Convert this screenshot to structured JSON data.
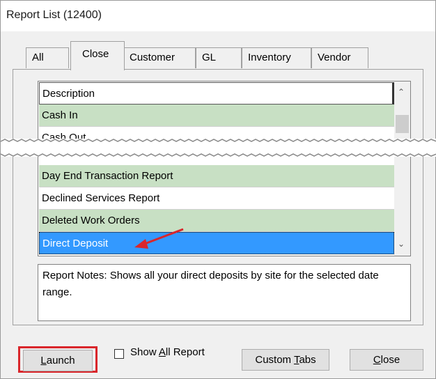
{
  "window": {
    "title": "Report List (12400)"
  },
  "tabs": [
    {
      "label": "All"
    },
    {
      "label": "Close"
    },
    {
      "label": "Customer"
    },
    {
      "label": "GL"
    },
    {
      "label": "Inventory"
    },
    {
      "label": "Vendor"
    }
  ],
  "list": {
    "header": "Description",
    "rows_top": [
      {
        "label": "Cash In"
      },
      {
        "label": "Cash Out"
      }
    ],
    "rows_bottom": [
      {
        "label": "Day End Transaction Report"
      },
      {
        "label": "Declined Services Report"
      },
      {
        "label": "Deleted Work Orders"
      },
      {
        "label": "Direct Deposit"
      }
    ]
  },
  "notes": {
    "text": "Report Notes:  Shows all your direct deposits by site for the selected date range."
  },
  "buttons": {
    "launch_pre": "",
    "launch_ul": "L",
    "launch_post": "aunch",
    "custom_pre": "Custom ",
    "custom_ul": "T",
    "custom_post": "abs",
    "close_pre": "",
    "close_ul": "C",
    "close_post": "lose"
  },
  "checkbox": {
    "pre": "Show ",
    "ul": "A",
    "post": "ll Report",
    "checked": false
  },
  "colors": {
    "row_green": "#c8e0c4",
    "selected": "#3399ff",
    "highlight": "#d9262b",
    "arrow": "#d9262b"
  },
  "icons": {
    "up": "chevron-up-icon",
    "down": "chevron-down-icon",
    "pointer": "red-arrow-icon"
  }
}
